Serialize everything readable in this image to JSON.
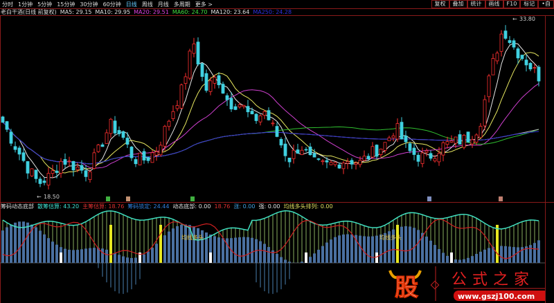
{
  "toolbar": {
    "tabs": [
      "分时",
      "1分钟",
      "5分钟",
      "15分钟",
      "30分钟",
      "60分钟",
      "日线",
      "周线",
      "月线",
      "多周期",
      "更多 >"
    ],
    "active": "日线",
    "right_buttons": [
      "复权",
      "叠加",
      "统计",
      "画线",
      "F10",
      "标记",
      "•自"
    ]
  },
  "ma_header": {
    "title": "老白干酒(日线 前复权)",
    "items": [
      {
        "label": "MA5: 29.15",
        "color": "#e0e0e0"
      },
      {
        "label": "MA10: 29.95",
        "color": "#e0e0e0"
      },
      {
        "label": "MA20: 29.51",
        "color": "#e040e0"
      },
      {
        "label": "MA60: 24.70",
        "color": "#40e040"
      },
      {
        "label": "MA120: 23.64",
        "color": "#e0e0e0"
      },
      {
        "label": "MA250: 24.28",
        "color": "#3030e0"
      }
    ]
  },
  "price_labels": {
    "high": "33.80",
    "low": "18.50"
  },
  "indicator_header": {
    "title": "筹码动态底部",
    "items": [
      {
        "label": "散筹估算: 43.20",
        "color": "#40e0d0"
      },
      {
        "label": "主筹估算: 18.76",
        "color": "#e03030"
      },
      {
        "label": "筹码锁定: 24.44",
        "color": "#3080e0"
      },
      {
        "label": "动态底部: 0.00",
        "color": "#e0e0e0"
      },
      {
        "label": "18.76",
        "color": "#e03030"
      },
      {
        "label": "涨: 0.00",
        "color": "#40a0e0"
      },
      {
        "label": "强: 0.00",
        "color": "#e0e0e0"
      },
      {
        "label": "均线多头排列: 0.00",
        "color": "#e0e060"
      }
    ]
  },
  "annotations": [
    "均线多头",
    "均线多头"
  ],
  "watermark": {
    "logo": "股",
    "name": "公式之家",
    "url": "www.gszj100.com"
  },
  "colors": {
    "up": "#ff3030",
    "down": "#40d0e0",
    "border": "#8a1a1a"
  },
  "chart_data": {
    "type": "candlestick",
    "ylim": [
      18.5,
      33.8
    ],
    "closes": [
      24.4,
      22.3,
      20.4,
      18.8,
      19.5,
      21,
      20.4,
      19.8,
      21.7,
      24.2,
      23.2,
      21,
      21,
      22,
      24.8,
      27.3,
      31.8,
      27.3,
      28.6,
      26.1,
      26.1,
      24.5,
      25.4,
      23.2,
      21,
      22.3,
      20.7,
      20.4,
      20.7,
      21,
      20.7,
      21.6,
      22.3,
      24,
      21.8,
      21.2,
      21.4,
      22.3,
      22.6,
      22.9,
      24,
      29.2,
      33,
      31.1,
      29.9,
      28.6
    ]
  }
}
